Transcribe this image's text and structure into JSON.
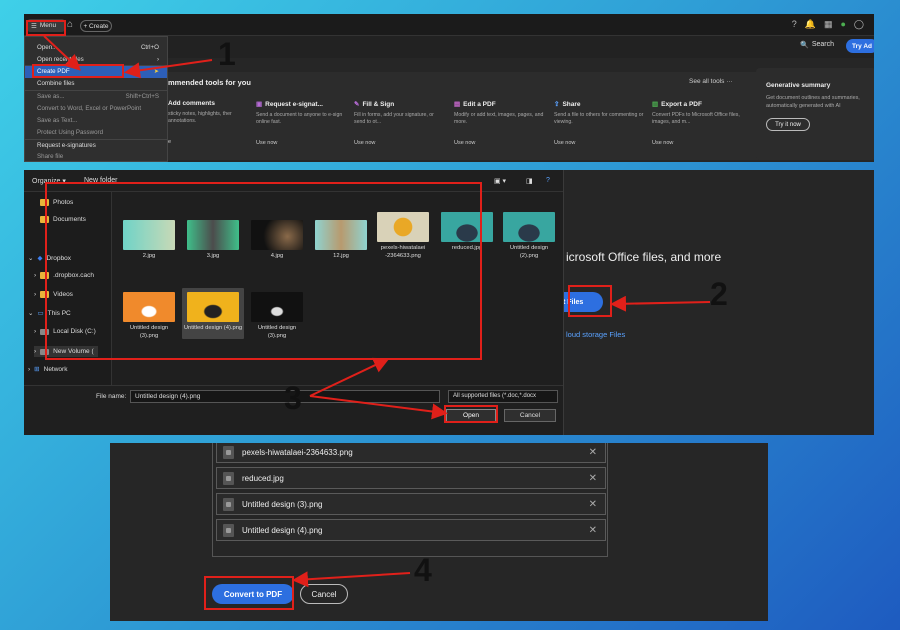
{
  "step1": {
    "menu_label": "Menu",
    "create_label": "+ Create",
    "search_label": "Search",
    "try_label": "Try Ad",
    "recommended_title": "mmended tools for you",
    "see_all": "See all tools",
    "tools": [
      {
        "name": "Add comments",
        "desc": "sticky notes, highlights, ther annotations.",
        "use": "e"
      },
      {
        "name": "Request e-signat...",
        "desc": "Send a document to anyone to e-sign online fast.",
        "use": "Use now"
      },
      {
        "name": "Fill & Sign",
        "desc": "Fill in forms, add your signature, or send to ot...",
        "use": "Use now"
      },
      {
        "name": "Edit a PDF",
        "desc": "Modify or add text, images, pages, and more.",
        "use": "Use now"
      },
      {
        "name": "Share",
        "desc": "Send a file to others for commenting or viewing.",
        "use": "Use now"
      },
      {
        "name": "Export a PDF",
        "desc": "Convert PDFs to Microsoft Office files, images, and m...",
        "use": "Use now"
      }
    ],
    "gen_title": "Generative summary",
    "gen_desc": "Get document outlines and summaries, automatically generated with AI",
    "gen_button": "Try it now",
    "menu_items": [
      {
        "label": "Open...",
        "shortcut": "Ctrl+O"
      },
      {
        "label": "Open recent files",
        "shortcut": "›"
      },
      {
        "label": "Create PDF",
        "shortcut": ""
      },
      {
        "label": "Combine files",
        "shortcut": ""
      },
      {
        "label": "Save as...",
        "shortcut": "Shift+Ctrl+S"
      },
      {
        "label": "Convert to Word, Excel or PowerPoint",
        "shortcut": ""
      },
      {
        "label": "Save as Text...",
        "shortcut": ""
      },
      {
        "label": "Protect Using Password",
        "shortcut": ""
      },
      {
        "label": "Request e-signatures",
        "shortcut": ""
      },
      {
        "label": "Share file",
        "shortcut": ""
      }
    ]
  },
  "step2": {
    "organize": "Organize ▾",
    "new_folder": "New folder",
    "sidebar": [
      "Photos",
      "Documents",
      "Dropbox",
      ".dropbox.cach",
      "Videos",
      "This PC",
      "Local Disk (C:)",
      "New Volume (",
      "Network"
    ],
    "files": [
      {
        "name": "2.jpg"
      },
      {
        "name": "3.jpg"
      },
      {
        "name": "4.jpg"
      },
      {
        "name": "12.jpg"
      },
      {
        "name": "pexels-hiwatalaei -2364633.png"
      },
      {
        "name": "reduced.jpg"
      },
      {
        "name": "Untitled design (2).png"
      },
      {
        "name": "Untitled design (3).png"
      },
      {
        "name": "Untitled design (4).png"
      },
      {
        "name": "Untitled design (3).png"
      }
    ],
    "file_name_label": "File name:",
    "file_name_value": "Untitled design (4).png",
    "filter": "All supported files (*.doc,*.docx",
    "open": "Open",
    "cancel": "Cancel",
    "heading": "icrosoft Office files, and more",
    "select_button": "t Files",
    "cloud": "loud storage Files"
  },
  "step3": {
    "files": [
      "pexels-hiwatalaei-2364633.png",
      "reduced.jpg",
      "Untitled design (3).png",
      "Untitled design (4).png"
    ],
    "convert": "Convert to PDF",
    "cancel": "Cancel"
  },
  "callouts": [
    "1",
    "2",
    "3",
    "4"
  ],
  "colors": {
    "accent": "#2d6fe0",
    "annotation": "#e0201a"
  }
}
